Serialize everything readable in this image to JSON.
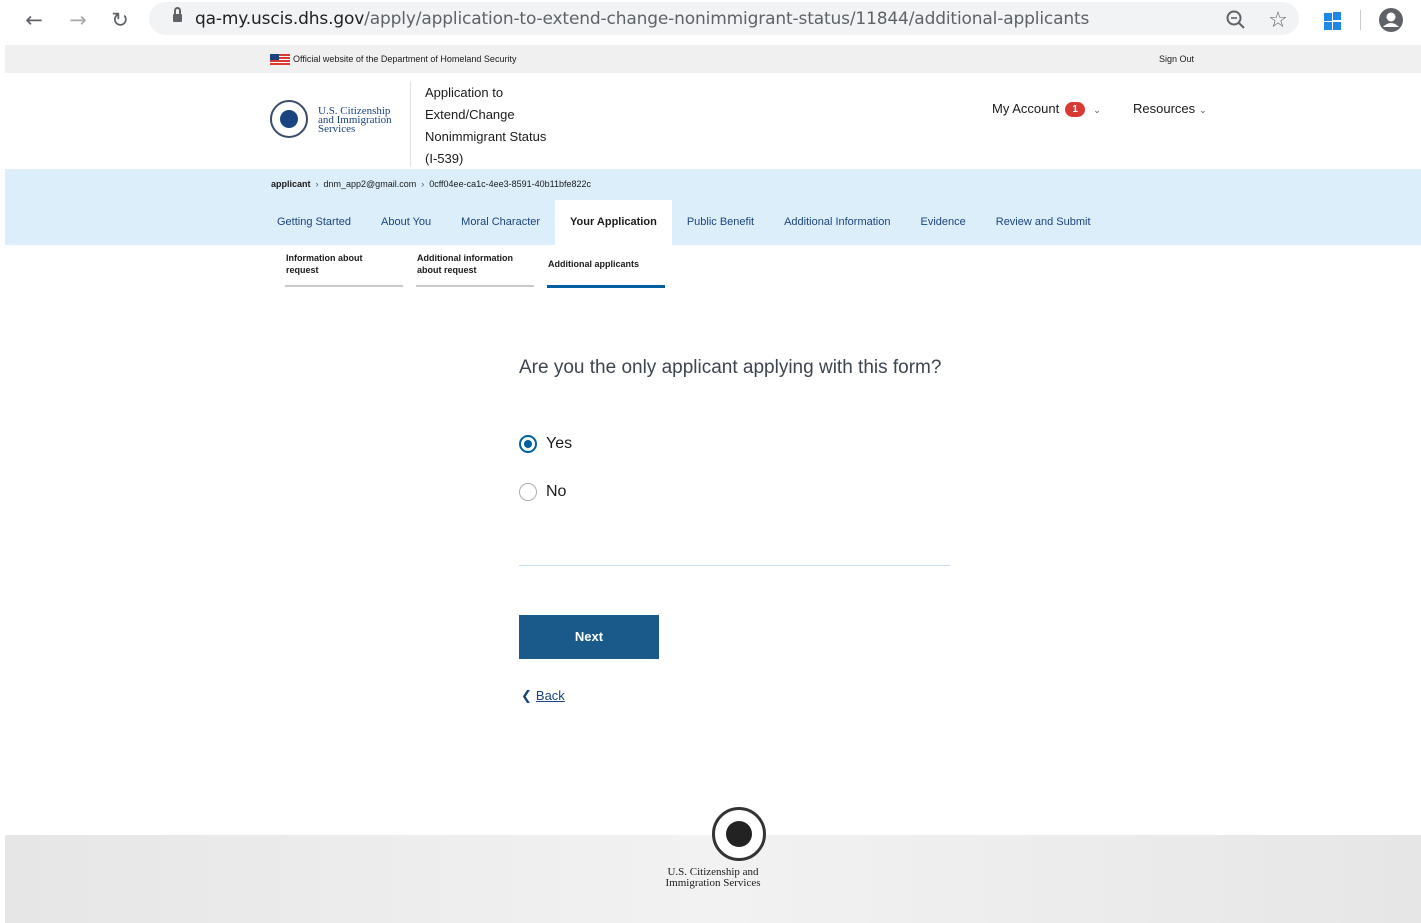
{
  "browser": {
    "url_host": "qa-my.uscis.dhs.gov",
    "url_path": "/apply/application-to-extend-change-nonimmigrant-status/11844/additional-applicants"
  },
  "gov_banner": {
    "text": "Official website of the Department of Homeland Security",
    "sign_out": "Sign Out"
  },
  "header": {
    "agency_line1": "U.S. Citizenship",
    "agency_line2": "and Immigration",
    "agency_line3": "Services",
    "app_title_line1": "Application to",
    "app_title_line2": "Extend/Change",
    "app_title_line3": "Nonimmigrant Status",
    "app_title_line4": "(I-539)",
    "my_account": "My Account",
    "notification_count": "1",
    "resources": "Resources"
  },
  "breadcrumb": {
    "root": "applicant",
    "email": "dnm_app2@gmail.com",
    "id": "0cff04ee-ca1c-4ee3-8591-40b11bfe822c"
  },
  "tabs": [
    {
      "label": "Getting Started"
    },
    {
      "label": "About You"
    },
    {
      "label": "Moral Character"
    },
    {
      "label": "Your Application"
    },
    {
      "label": "Public Benefit"
    },
    {
      "label": "Additional Information"
    },
    {
      "label": "Evidence"
    },
    {
      "label": "Review and Submit"
    }
  ],
  "subtabs": [
    {
      "line1": "Information about",
      "line2": "request"
    },
    {
      "line1": "Additional information",
      "line2": "about request"
    },
    {
      "line1": "Additional applicants",
      "line2": ""
    }
  ],
  "form": {
    "question": "Are you the only applicant applying with this form?",
    "options": [
      {
        "label": "Yes",
        "selected": true
      },
      {
        "label": "No",
        "selected": false
      }
    ],
    "next": "Next",
    "back": "Back"
  },
  "footer": {
    "agency_line1": "U.S. Citizenship and",
    "agency_line2": "Immigration Services"
  }
}
